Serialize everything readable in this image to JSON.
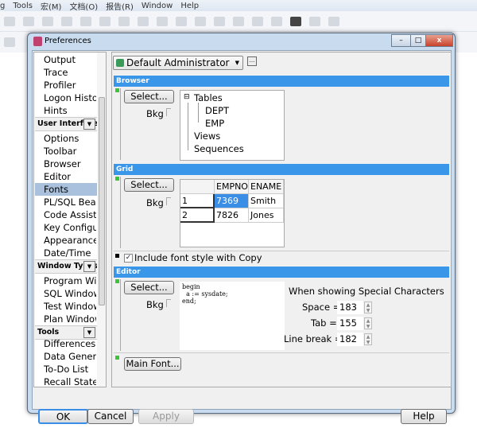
{
  "app_menu": [
    "g",
    "Tools",
    "宏(M)",
    "文档(O)",
    "报告(R)",
    "Window",
    "Help"
  ],
  "dialog": {
    "title": "Preferences",
    "minimize": "–",
    "maximize": "□",
    "close": "x"
  },
  "nav": {
    "items_top": [
      "Output",
      "Trace",
      "Profiler",
      "Logon History",
      "Hints"
    ],
    "group_user_interface": "User Interface",
    "items_ui": [
      "Options",
      "Toolbar",
      "Browser",
      "Editor",
      "Fonts",
      "PL/SQL Beautifier",
      "Code Assistant",
      "Key Configuration",
      "Appearance",
      "Date/Time"
    ],
    "group_window_types": "Window Types",
    "items_window": [
      "Program Window",
      "SQL Window",
      "Test Window",
      "Plan Window"
    ],
    "group_tools": "Tools",
    "items_tools": [
      "Differences",
      "Data Generator",
      "To-Do List",
      "Recall Statement"
    ],
    "selected": "Fonts"
  },
  "profile": {
    "value": "Default Administrator",
    "more": "..."
  },
  "browser": {
    "header": "Browser",
    "select": "Select...",
    "bkg": "Bkg",
    "tree": [
      "Tables",
      "DEPT",
      "EMP",
      "Views",
      "Sequences"
    ]
  },
  "grid": {
    "header": "Grid",
    "select": "Select...",
    "bkg": "Bkg",
    "columns": [
      "",
      "EMPNO",
      "ENAME"
    ],
    "rows": [
      [
        "1",
        "7369",
        "Smith"
      ],
      [
        "2",
        "7826",
        "Jones"
      ]
    ]
  },
  "include_font_style": {
    "label": "Include font style with Copy",
    "checked": true
  },
  "editor": {
    "header": "Editor",
    "select": "Select...",
    "bkg": "Bkg",
    "sample": "begin\n  a := sysdate;\nend;",
    "special_title": "When showing Special Characters",
    "space_label": "Space =",
    "space": "183",
    "tab_label": "Tab =",
    "tab": "155",
    "linebreak_label": "Line break =",
    "linebreak": "182"
  },
  "main_font": "Main Font...",
  "footer": {
    "ok": "OK",
    "cancel": "Cancel",
    "apply": "Apply",
    "help": "Help"
  },
  "colors": {
    "section_header": "#3a96e8",
    "selected_nav": "#a9c1dc",
    "grid_selected": "#3a8ee6"
  }
}
